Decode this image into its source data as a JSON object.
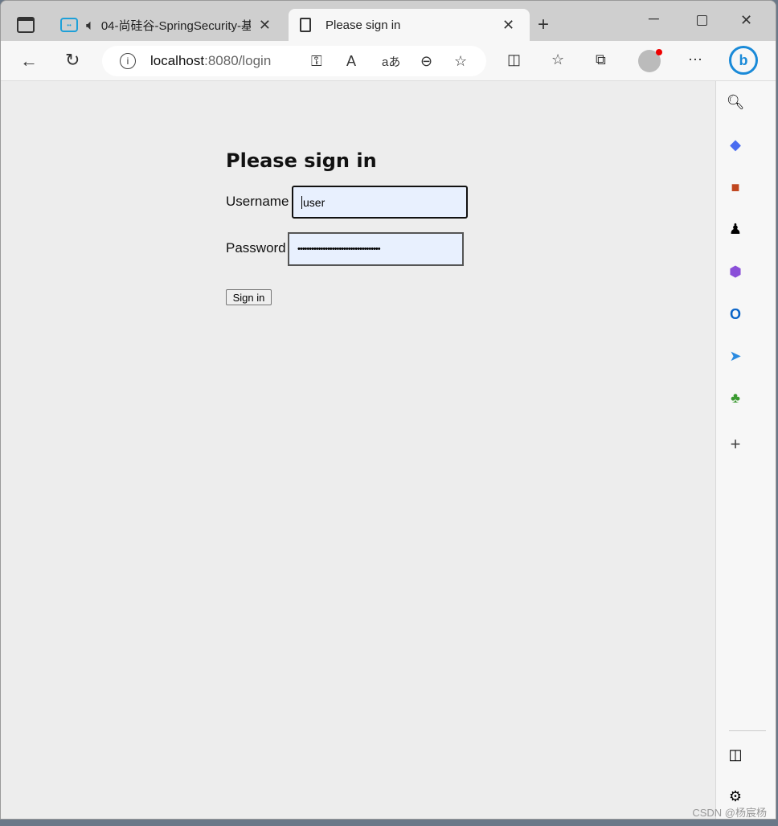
{
  "browser": {
    "tabs": [
      {
        "title": "04-尚硅谷-SpringSecurity-基",
        "icon": "bilibili-icon",
        "audio": true
      },
      {
        "title": "Please sign in",
        "icon": "page-icon",
        "active": true
      }
    ],
    "address": {
      "host": "localhost",
      "rest": ":8080/login"
    }
  },
  "page": {
    "heading": "Please sign in",
    "username_label": "Username",
    "username_value": "user",
    "password_label": "Password",
    "password_value": "••••••••••••••••••••••••••••••••••••",
    "submit": "Sign in"
  },
  "watermark": "CSDN @杨宸杨"
}
